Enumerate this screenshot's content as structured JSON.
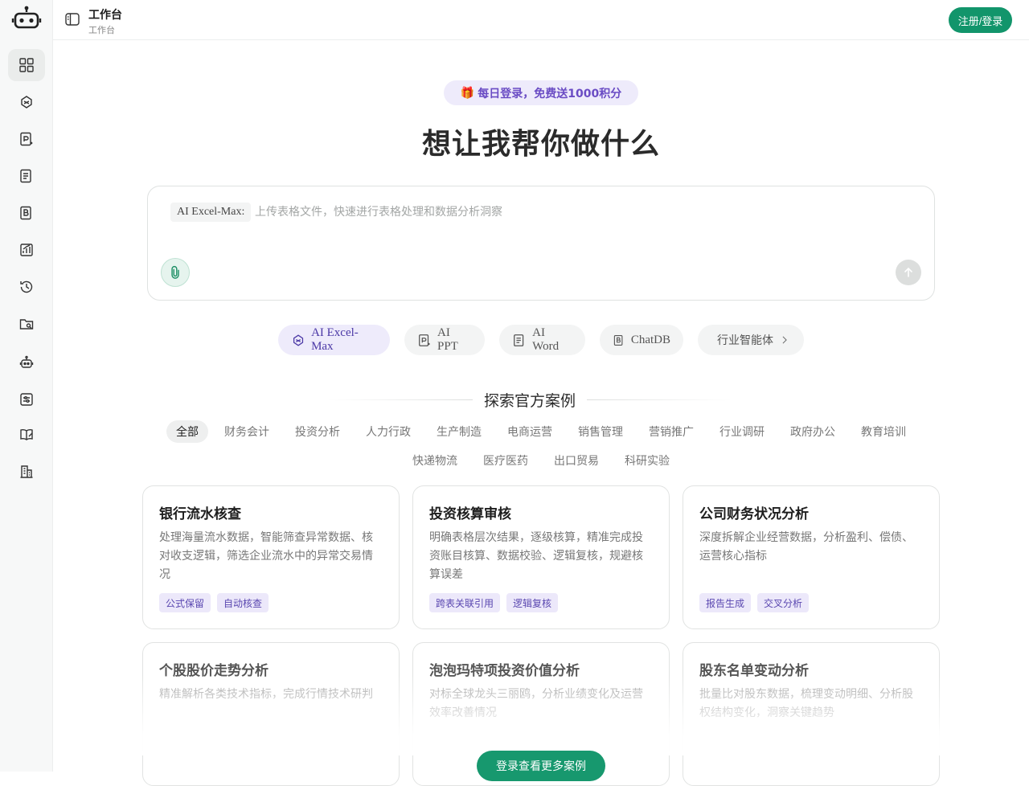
{
  "header": {
    "title": "工作台",
    "subtitle": "工作台",
    "login_label": "注册/登录"
  },
  "sidebar": {
    "items": [
      {
        "icon": "grid-icon"
      },
      {
        "icon": "excel-ai-icon"
      },
      {
        "icon": "ppt-icon"
      },
      {
        "icon": "word-icon"
      },
      {
        "icon": "chatdb-icon"
      },
      {
        "icon": "chart-icon"
      },
      {
        "icon": "history-icon"
      },
      {
        "icon": "folder-icon"
      },
      {
        "icon": "robot-icon"
      },
      {
        "icon": "settings-list-icon"
      },
      {
        "icon": "book-icon"
      },
      {
        "icon": "building-icon"
      }
    ]
  },
  "promo": {
    "icon": "🎁",
    "text": "每日登录，免费送1000积分"
  },
  "hero": {
    "title": "想让我帮你做什么"
  },
  "input": {
    "mode_label": "AI Excel-Max:",
    "placeholder": "上传表格文件，快速进行表格处理和数据分析洞察"
  },
  "tools": [
    {
      "label": "AI Excel-Max"
    },
    {
      "label": "AI PPT"
    },
    {
      "label": "AI Word"
    },
    {
      "label": "ChatDB"
    },
    {
      "label": "行业智能体"
    }
  ],
  "cases": {
    "title": "探索官方案例",
    "categories": [
      "全部",
      "财务会计",
      "投资分析",
      "人力行政",
      "生产制造",
      "电商运营",
      "销售管理",
      "营销推广",
      "行业调研",
      "政府办公",
      "教育培训",
      "快递物流",
      "医疗医药",
      "出口贸易",
      "科研实验"
    ],
    "cards": [
      {
        "title": "银行流水核查",
        "desc": "处理海量流水数据，智能筛查异常数据、核对收支逻辑，筛选企业流水中的异常交易情况",
        "tags": [
          "公式保留",
          "自动核查"
        ]
      },
      {
        "title": "投资核算审核",
        "desc": "明确表格层次结果，逐级核算，精准完成投资账目核算、数据校验、逻辑复核，规避核算误差",
        "tags": [
          "跨表关联引用",
          "逻辑复核"
        ]
      },
      {
        "title": "公司财务状况分析",
        "desc": "深度拆解企业经营数据，分析盈利、偿债、运营核心指标",
        "tags": [
          "报告生成",
          "交叉分析"
        ]
      },
      {
        "title": "个股股价走势分析",
        "desc": "精准解析各类技术指标，完成行情技术研判"
      },
      {
        "title": "泡泡玛特项投资价值分析",
        "desc": "对标全球龙头三丽鸥，分析业绩变化及运营效率改善情况"
      },
      {
        "title": "股东名单变动分析",
        "desc": "批量比对股东数据，梳理变动明细、分析股权结构变化，洞察关键趋势"
      }
    ],
    "more_label": "登录查看更多案例"
  }
}
